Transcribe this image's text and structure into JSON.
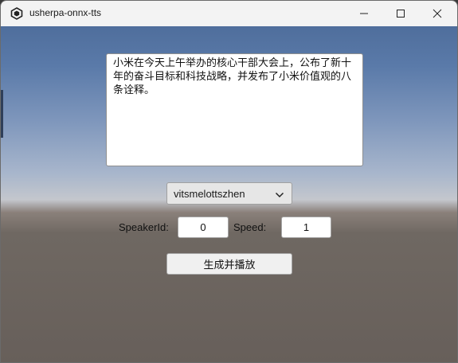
{
  "window": {
    "title": "usherpa-onnx-tts",
    "controls": {
      "minimize_icon": "minimize-icon",
      "maximize_icon": "maximize-icon",
      "close_icon": "close-icon"
    }
  },
  "main": {
    "text_input": {
      "value": "小米在今天上午举办的核心干部大会上，公布了新十年的奋斗目标和科技战略，并发布了小米价值观的八条诠释。"
    },
    "model_dropdown": {
      "selected": "vitsmelottszhen",
      "icon": "chevron-down-icon"
    },
    "speaker_id": {
      "label": "SpeakerId:",
      "value": "0"
    },
    "speed": {
      "label": "Speed:",
      "value": "1"
    },
    "generate_button": {
      "label": "生成并播放"
    }
  },
  "colors": {
    "sky_top": "#4f6e9c",
    "horizon": "#c4c7cd",
    "ground": "#675f5a",
    "titlebar": "#f3f3f3"
  }
}
